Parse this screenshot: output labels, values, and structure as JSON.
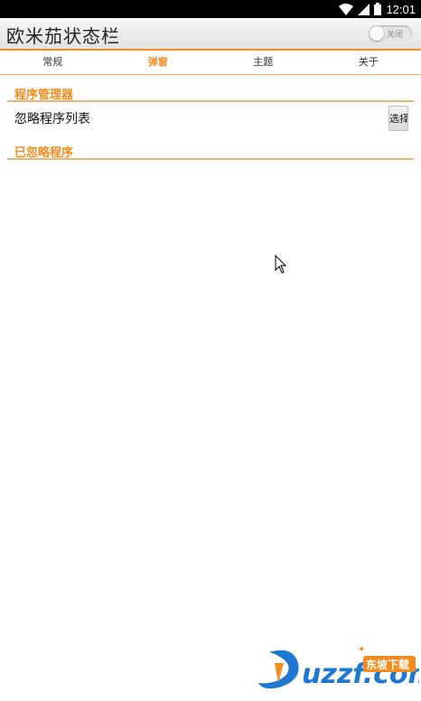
{
  "status_bar": {
    "time": "12:01",
    "icons": [
      "wifi-icon",
      "signal-icon",
      "battery-icon"
    ]
  },
  "action_bar": {
    "title": "欧米茄状态栏",
    "toggle_label": "关闭",
    "toggle_on": false
  },
  "tabs": [
    {
      "label": "常规",
      "active": false
    },
    {
      "label": "弹窗",
      "active": true
    },
    {
      "label": "主题",
      "active": false
    },
    {
      "label": "关于",
      "active": false
    }
  ],
  "sections": [
    {
      "title": "程序管理器",
      "items": [
        {
          "label": "忽略程序列表",
          "button": "选择"
        }
      ]
    },
    {
      "title": "已忽略程序",
      "items": []
    }
  ],
  "colors": {
    "accent": "#f28c1e",
    "divider": "#f6b36b",
    "status_bar": "#000000"
  },
  "watermark": {
    "text": "uzzf.com",
    "badge": "东坡下载"
  }
}
